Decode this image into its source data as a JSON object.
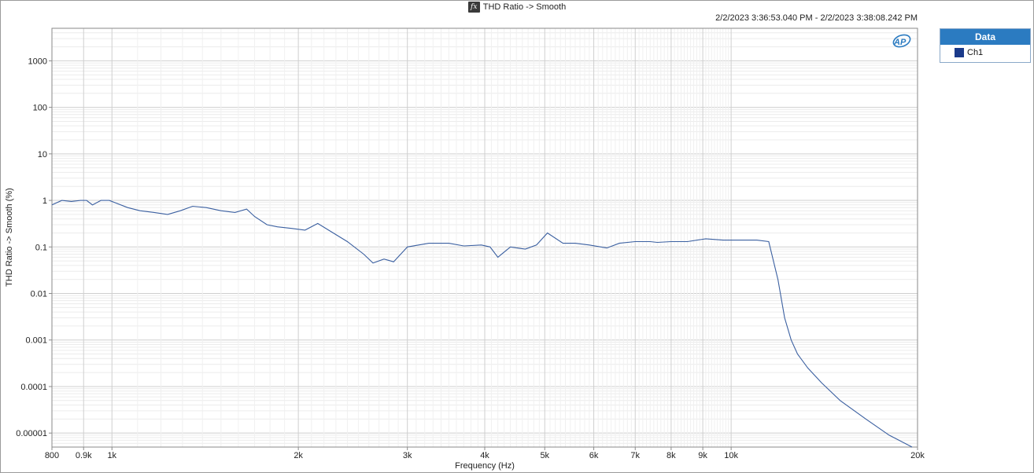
{
  "header": {
    "title": "THD Ratio -> Smooth",
    "timestamp": "2/2/2023 3:36:53.040 PM - 2/2/2023 3:38:08.242 PM",
    "logo_text": "AP"
  },
  "legend": {
    "title": "Data",
    "items": [
      {
        "label": "Ch1",
        "color": "#1a3a8a"
      }
    ]
  },
  "chart_data": {
    "type": "line",
    "title": "THD Ratio -> Smooth",
    "xlabel": "Frequency (Hz)",
    "ylabel": "THD Ratio -> Smooth (%)",
    "x_scale": "log",
    "y_scale": "log",
    "xlim": [
      800,
      20000
    ],
    "ylim": [
      5e-06,
      5000
    ],
    "grid": true,
    "x_ticks": [
      {
        "value": 800,
        "label": "800"
      },
      {
        "value": 900,
        "label": "0.9k"
      },
      {
        "value": 1000,
        "label": "1k"
      },
      {
        "value": 2000,
        "label": "2k"
      },
      {
        "value": 3000,
        "label": "3k"
      },
      {
        "value": 4000,
        "label": "4k"
      },
      {
        "value": 5000,
        "label": "5k"
      },
      {
        "value": 6000,
        "label": "6k"
      },
      {
        "value": 7000,
        "label": "7k"
      },
      {
        "value": 8000,
        "label": "8k"
      },
      {
        "value": 9000,
        "label": "9k"
      },
      {
        "value": 10000,
        "label": "10k"
      },
      {
        "value": 20000,
        "label": "20k"
      }
    ],
    "y_ticks": [
      {
        "value": 1000,
        "label": "1000"
      },
      {
        "value": 100,
        "label": "100"
      },
      {
        "value": 10,
        "label": "10"
      },
      {
        "value": 1,
        "label": "1"
      },
      {
        "value": 0.1,
        "label": "0.1"
      },
      {
        "value": 0.01,
        "label": "0.01"
      },
      {
        "value": 0.001,
        "label": "0.001"
      },
      {
        "value": 0.0001,
        "label": "0.0001"
      },
      {
        "value": 1e-05,
        "label": "0.00001"
      }
    ],
    "series": [
      {
        "name": "Ch1",
        "color": "#3a5fa0",
        "x": [
          800,
          830,
          860,
          890,
          910,
          930,
          960,
          990,
          1010,
          1060,
          1110,
          1170,
          1230,
          1290,
          1350,
          1420,
          1500,
          1580,
          1650,
          1700,
          1780,
          1850,
          1950,
          2050,
          2150,
          2250,
          2400,
          2550,
          2640,
          2750,
          2850,
          3000,
          3250,
          3500,
          3700,
          3950,
          4080,
          4200,
          4400,
          4650,
          4850,
          5050,
          5350,
          5600,
          5900,
          6300,
          6600,
          7000,
          7400,
          7600,
          8000,
          8500,
          9100,
          9700,
          10400,
          11000,
          11500,
          11900,
          12200,
          12500,
          12800,
          13300,
          14000,
          15000,
          16500,
          18000,
          19600
        ],
        "y": [
          0.8,
          1.0,
          0.95,
          1.0,
          1.0,
          0.8,
          1.0,
          1.0,
          0.9,
          0.7,
          0.6,
          0.55,
          0.5,
          0.6,
          0.75,
          0.7,
          0.6,
          0.55,
          0.65,
          0.45,
          0.3,
          0.27,
          0.25,
          0.23,
          0.32,
          0.22,
          0.13,
          0.07,
          0.045,
          0.055,
          0.048,
          0.1,
          0.12,
          0.12,
          0.105,
          0.11,
          0.1,
          0.06,
          0.1,
          0.09,
          0.11,
          0.2,
          0.12,
          0.12,
          0.11,
          0.095,
          0.12,
          0.13,
          0.13,
          0.125,
          0.13,
          0.13,
          0.15,
          0.14,
          0.14,
          0.14,
          0.13,
          0.02,
          0.003,
          0.001,
          0.0005,
          0.00025,
          0.00012,
          5e-05,
          2e-05,
          9e-06,
          5e-06
        ]
      }
    ]
  }
}
